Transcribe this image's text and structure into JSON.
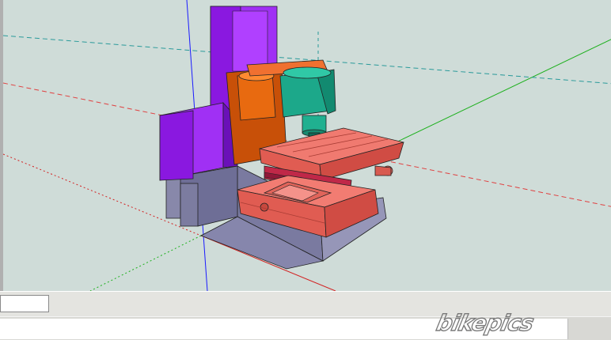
{
  "app": {
    "status_text": "",
    "watermark": "bikepics"
  },
  "model": {
    "description_icon": "cnc-milling-machine-model",
    "colors": {
      "viewport_bg": "#cfdcd8",
      "column": "#9a1cf0",
      "motor": "#d9600a",
      "spindle_head": "#1ca88a",
      "table": "#e86a5e",
      "base": "#7a7aa0",
      "axis_red": "#d22222",
      "axis_green": "#1db01d",
      "axis_blue": "#1a1aff"
    }
  }
}
